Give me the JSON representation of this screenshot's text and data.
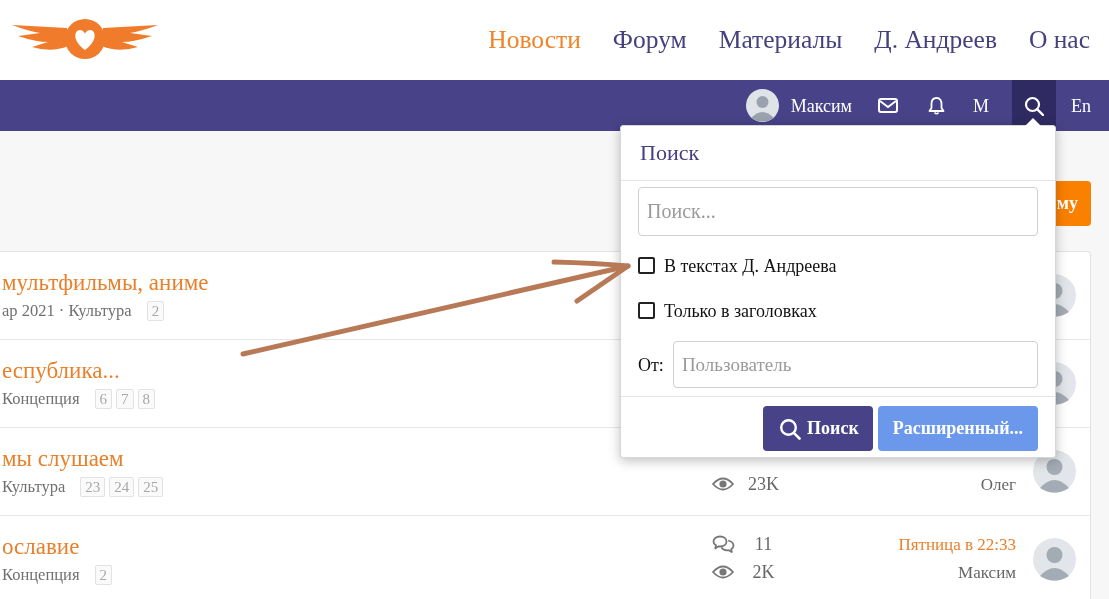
{
  "header": {
    "nav": [
      {
        "label": "Новости",
        "selected": true
      },
      {
        "label": "Форум",
        "selected": false
      },
      {
        "label": "Материалы",
        "selected": false
      },
      {
        "label": "Д. Андреев",
        "selected": false
      },
      {
        "label": "О нас",
        "selected": false
      }
    ]
  },
  "user_bar": {
    "user": "Максим",
    "letter_link": "М",
    "search_active": true,
    "language": "En"
  },
  "toolbar": {
    "button_label": "му"
  },
  "threads": [
    {
      "title": "мультфильмы, аниме",
      "meta": "ар 2021 · Культура",
      "pages": [
        "2"
      ]
    },
    {
      "title": "еспублика...",
      "meta": "Концепция",
      "pages": [
        "6",
        "7",
        "8"
      ]
    },
    {
      "title": "мы слушаем",
      "meta": "Культура",
      "pages": [
        "23",
        "24",
        "25"
      ],
      "views": "23K",
      "last_user": "Олег"
    },
    {
      "title": "ославие",
      "meta": "Концепция",
      "pages": [
        "2"
      ],
      "replies": "11",
      "views": "2K",
      "last_date": "Пятница в 22:33",
      "last_user": "Максим"
    }
  ],
  "search_popup": {
    "title": "Поиск",
    "query": {
      "placeholder": "Поиск..."
    },
    "options": [
      {
        "label": "В текстах Д. Андреева",
        "checked": false
      },
      {
        "label": "Только в заголовках",
        "checked": false
      }
    ],
    "from_label": "От:",
    "from_field": {
      "placeholder": "Пользователь"
    },
    "buttons": [
      {
        "label": "Поиск",
        "kind": "primary"
      },
      {
        "label": "Расширенный...",
        "kind": "secondary"
      }
    ]
  }
}
